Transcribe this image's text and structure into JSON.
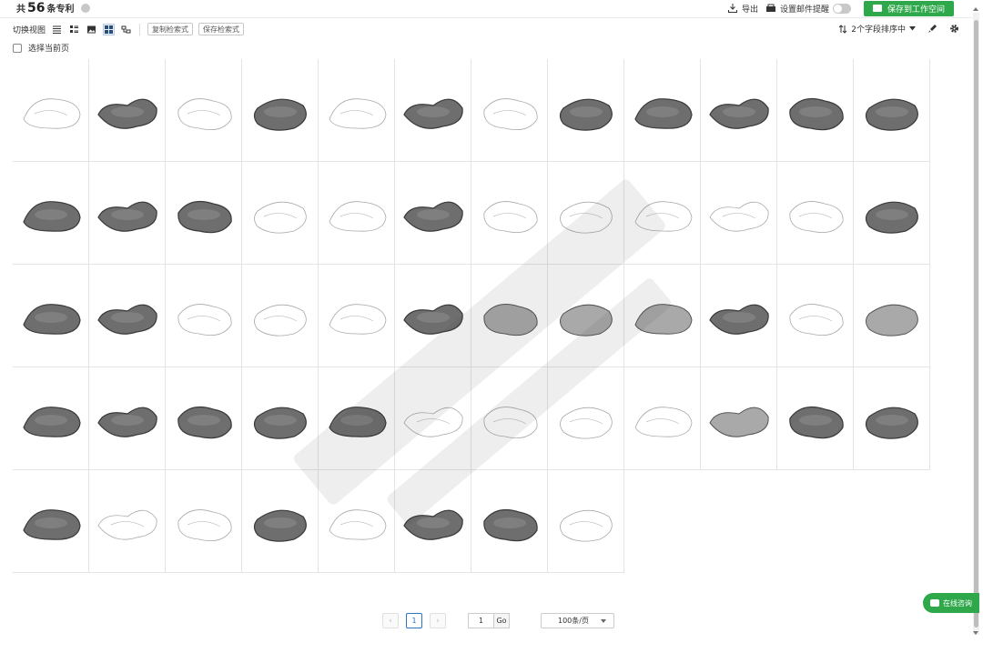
{
  "header": {
    "prefix": "共",
    "count": "56",
    "suffix": "条专利",
    "export_label": "导出",
    "email_alert_label": "设置邮件提醒",
    "save_workspace_label": "保存到工作空间"
  },
  "toolbar": {
    "switch_view_label": "切换视图",
    "copy_query_label": "复制检索式",
    "save_query_label": "保存检索式",
    "sort_label": "2个字段排序中"
  },
  "selection": {
    "select_page_label": "选择当前页"
  },
  "grid": {
    "total_items": 56,
    "columns": 12,
    "items": [
      {
        "style": "line"
      },
      {
        "style": "dark"
      },
      {
        "style": "line"
      },
      {
        "style": "dark"
      },
      {
        "style": "line"
      },
      {
        "style": "dark"
      },
      {
        "style": "line"
      },
      {
        "style": "dark"
      },
      {
        "style": "dark"
      },
      {
        "style": "dark"
      },
      {
        "style": "dark"
      },
      {
        "style": "dark"
      },
      {
        "style": "dark"
      },
      {
        "style": "dark"
      },
      {
        "style": "dark"
      },
      {
        "style": "line"
      },
      {
        "style": "line"
      },
      {
        "style": "dark"
      },
      {
        "style": "line"
      },
      {
        "style": "line"
      },
      {
        "style": "line"
      },
      {
        "style": "line"
      },
      {
        "style": "line"
      },
      {
        "style": "dark"
      },
      {
        "style": "dark"
      },
      {
        "style": "dark"
      },
      {
        "style": "line"
      },
      {
        "style": "line"
      },
      {
        "style": "line"
      },
      {
        "style": "dark"
      },
      {
        "style": "smooth"
      },
      {
        "style": "smooth"
      },
      {
        "style": "smooth"
      },
      {
        "style": "dark"
      },
      {
        "style": "line"
      },
      {
        "style": "smooth"
      },
      {
        "style": "dark"
      },
      {
        "style": "dark"
      },
      {
        "style": "dark"
      },
      {
        "style": "dark"
      },
      {
        "style": "dark"
      },
      {
        "style": "line"
      },
      {
        "style": "line"
      },
      {
        "style": "line"
      },
      {
        "style": "line"
      },
      {
        "style": "smooth"
      },
      {
        "style": "dark"
      },
      {
        "style": "dark"
      },
      {
        "style": "dark"
      },
      {
        "style": "line"
      },
      {
        "style": "line"
      },
      {
        "style": "dark"
      },
      {
        "style": "line"
      },
      {
        "style": "dark"
      },
      {
        "style": "dark"
      },
      {
        "style": "line"
      }
    ]
  },
  "pagination": {
    "prev": "‹",
    "current_page": "1",
    "next": "›",
    "goto_value": "1",
    "go_label": "Go",
    "per_page_label": "100条/页"
  },
  "chat": {
    "label": "在线咨询"
  },
  "colors": {
    "accent_green": "#2ea84b",
    "link_blue": "#2f74c0"
  }
}
